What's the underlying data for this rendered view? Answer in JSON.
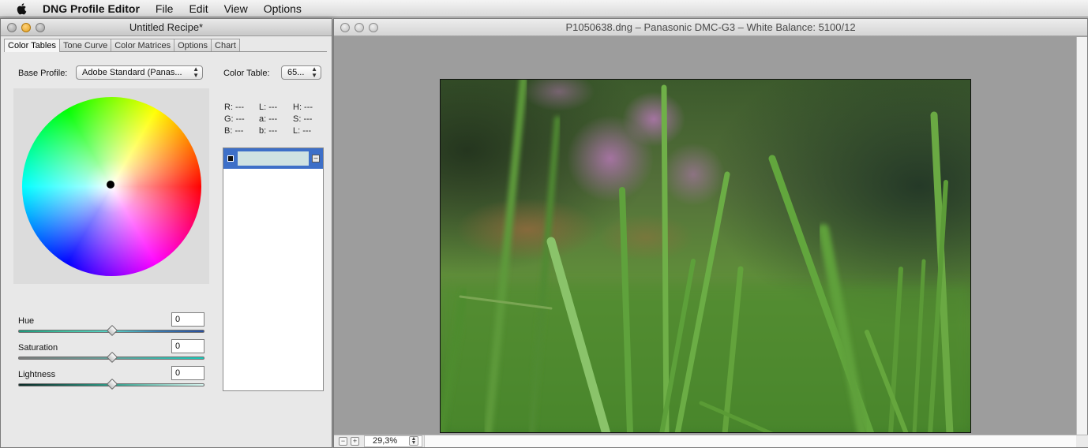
{
  "menubar": {
    "app_name": "DNG Profile Editor",
    "items": [
      "File",
      "Edit",
      "View",
      "Options"
    ]
  },
  "recipe_window": {
    "title": "Untitled Recipe*",
    "tabs": [
      "Color Tables",
      "Tone Curve",
      "Color Matrices",
      "Options",
      "Chart"
    ],
    "active_tab": "Color Tables",
    "base_profile_label": "Base Profile:",
    "base_profile_value": "Adobe Standard (Panas...",
    "color_table_label": "Color Table:",
    "color_table_value": "65...",
    "readout": {
      "r": "R:  ---",
      "g": "G:  ---",
      "b": "B:  ---",
      "l1": "L:  ---",
      "a": "a:  ---",
      "b2": "b:  ---",
      "h": "H:  ---",
      "s": "S:  ---",
      "l2": "L:  ---"
    },
    "hue_label": "Hue",
    "hue_value": "0",
    "saturation_label": "Saturation",
    "saturation_value": "0",
    "lightness_label": "Lightness",
    "lightness_value": "0",
    "slider_positions": {
      "hue": 0.5,
      "saturation": 0.5,
      "lightness": 0.5
    }
  },
  "image_window": {
    "title": "P1050638.dng  – Panasonic DMC-G3 – White Balance: 5100/12",
    "zoom": "29,3%"
  },
  "colors": {
    "selection_blue": "#3d6fc8",
    "canvas_gray": "#9d9d9d"
  }
}
